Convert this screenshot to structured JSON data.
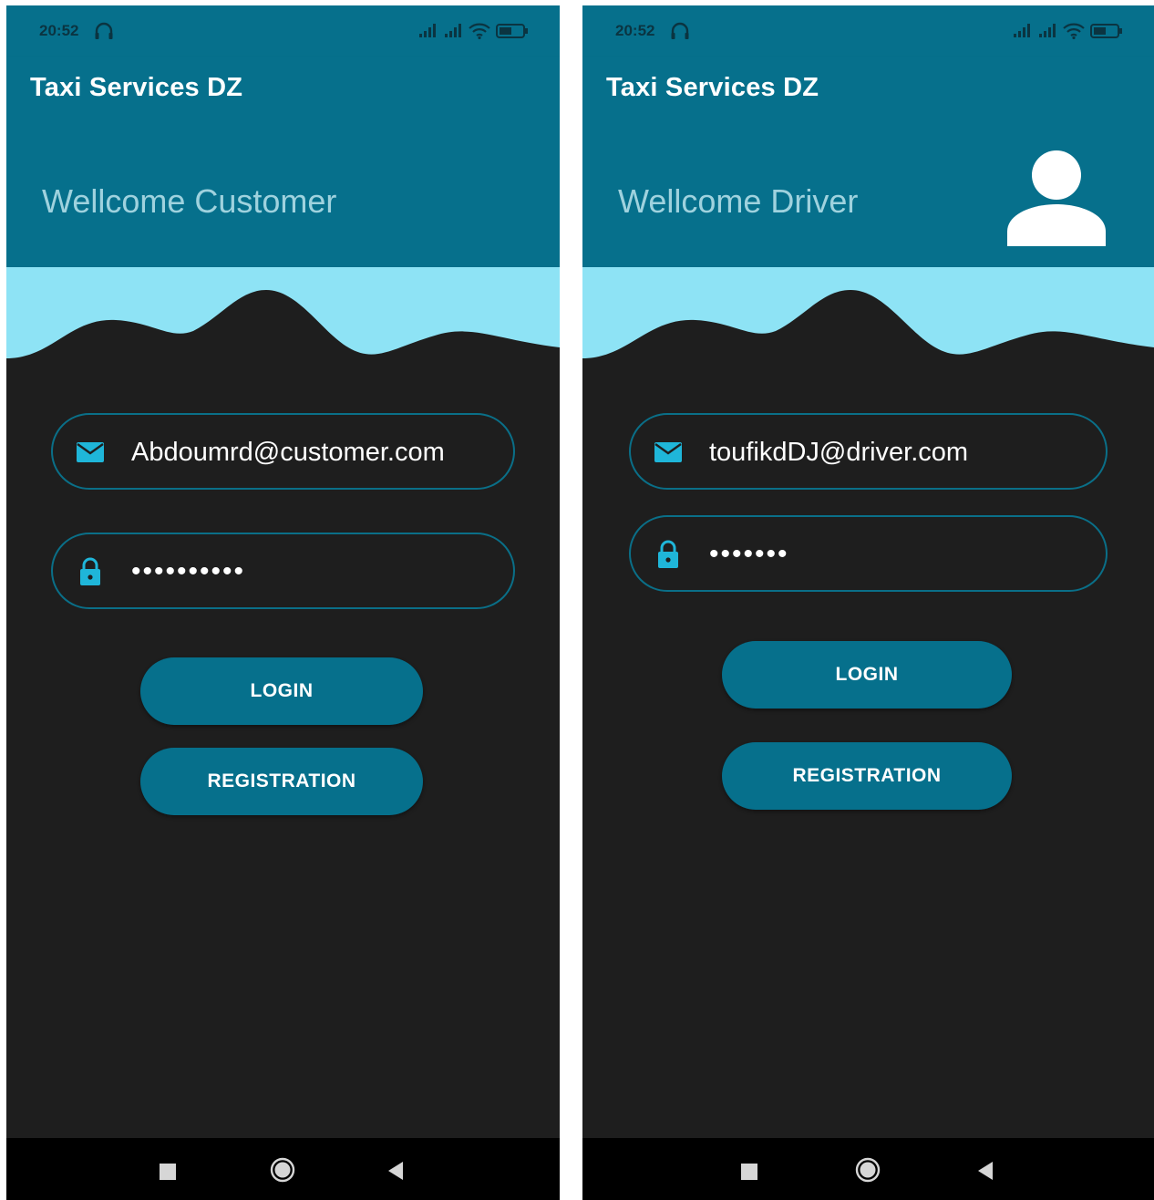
{
  "screens": [
    {
      "status": {
        "time": "20:52"
      },
      "app_title": "Taxi Services DZ",
      "welcome": "Wellcome Customer",
      "email": {
        "value": "Abdoumrd@customer.com",
        "icon": "mail-icon"
      },
      "password": {
        "value": "••••••••••",
        "icon": "lock-icon"
      },
      "login_label": "LOGIN",
      "registration_label": "REGISTRATION"
    },
    {
      "status": {
        "time": "20:52"
      },
      "app_title": "Taxi Services DZ",
      "welcome": "Wellcome Driver",
      "avatar_icon": "user-avatar-icon",
      "email": {
        "value": "toufikdDJ@driver.com",
        "icon": "mail-icon"
      },
      "password": {
        "value": "•••••••",
        "icon": "lock-icon"
      },
      "login_label": "LOGIN",
      "registration_label": "REGISTRATION"
    }
  ],
  "colors": {
    "primary": "#06708c",
    "accent": "#1fb6d9",
    "wave": "#8ee3f5",
    "background": "#1e1e1e",
    "welcome_text": "#9fd2de"
  }
}
